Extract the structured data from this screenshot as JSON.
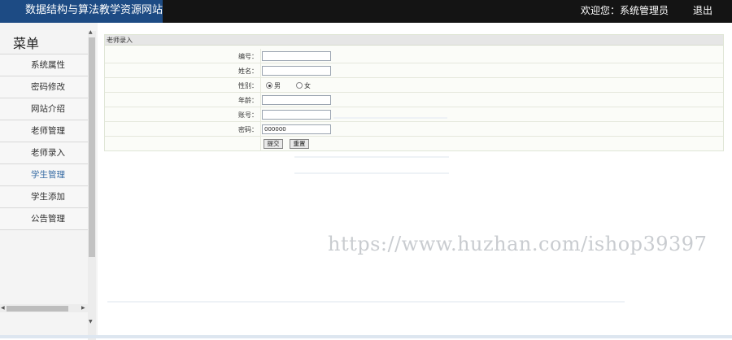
{
  "header": {
    "site_title": "数据结构与算法教学资源网站",
    "welcome_text": "欢迎您：系统管理员",
    "logout_label": "退出"
  },
  "sidebar": {
    "title": "菜单",
    "items": [
      {
        "label": "系统属性"
      },
      {
        "label": "密码修改"
      },
      {
        "label": "网站介绍"
      },
      {
        "label": "老师管理"
      },
      {
        "label": "老师录入"
      },
      {
        "label": "学生管理"
      },
      {
        "label": "学生添加"
      },
      {
        "label": "公告管理"
      }
    ]
  },
  "form": {
    "title": "老师录入",
    "fields": {
      "id_label": "编号：",
      "name_label": "姓名：",
      "gender_label": "性别：",
      "age_label": "年龄：",
      "account_label": "账号：",
      "password_label": "密码：",
      "password_value": "000000"
    },
    "gender_options": [
      "男",
      "女"
    ],
    "gender_selected": "男",
    "submit_label": "提交",
    "reset_label": "重置"
  },
  "watermark": "https://www.huzhan.com/ishop39397"
}
